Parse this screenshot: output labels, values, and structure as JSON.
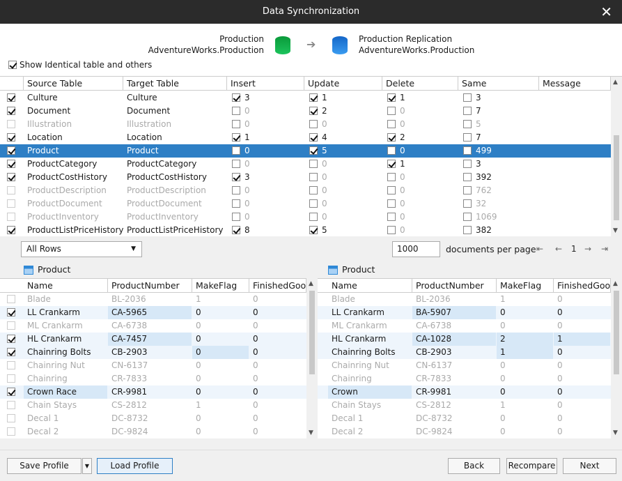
{
  "window": {
    "title": "Data Synchronization",
    "close": "✕"
  },
  "header": {
    "source": {
      "line1": "Production",
      "line2": "AdventureWorks.Production"
    },
    "target": {
      "line1": "Production Replication",
      "line2": "AdventureWorks.Production"
    },
    "arrow": "➔",
    "show_identical": {
      "label": "Show Identical table and others",
      "checked": true
    }
  },
  "tables": {
    "columns": [
      "Source Table",
      "Target Table",
      "Insert",
      "Update",
      "Delete",
      "Same",
      "Message"
    ],
    "rows": [
      {
        "checked": true,
        "source": "Culture",
        "target": "Culture",
        "insert": {
          "c": true,
          "v": "3"
        },
        "update": {
          "c": true,
          "v": "1"
        },
        "delete": {
          "c": true,
          "v": "1"
        },
        "same": {
          "c": false,
          "v": "3"
        },
        "dim": false,
        "sel": false
      },
      {
        "checked": true,
        "source": "Document",
        "target": "Document",
        "insert": {
          "c": false,
          "v": "0"
        },
        "update": {
          "c": true,
          "v": "2"
        },
        "delete": {
          "c": false,
          "v": "0"
        },
        "same": {
          "c": false,
          "v": "7"
        },
        "dim": false,
        "sel": false
      },
      {
        "checked": false,
        "source": "Illustration",
        "target": "Illustration",
        "insert": {
          "c": false,
          "v": "0"
        },
        "update": {
          "c": false,
          "v": "0"
        },
        "delete": {
          "c": false,
          "v": "0"
        },
        "same": {
          "c": false,
          "v": "5"
        },
        "dim": true,
        "sel": false
      },
      {
        "checked": true,
        "source": "Location",
        "target": "Location",
        "insert": {
          "c": true,
          "v": "1"
        },
        "update": {
          "c": true,
          "v": "4"
        },
        "delete": {
          "c": true,
          "v": "2"
        },
        "same": {
          "c": false,
          "v": "7"
        },
        "dim": false,
        "sel": false
      },
      {
        "checked": true,
        "source": "Product",
        "target": "Product",
        "insert": {
          "c": false,
          "v": "0"
        },
        "update": {
          "c": true,
          "v": "5"
        },
        "delete": {
          "c": false,
          "v": "0"
        },
        "same": {
          "c": false,
          "v": "499"
        },
        "dim": false,
        "sel": true
      },
      {
        "checked": true,
        "source": "ProductCategory",
        "target": "ProductCategory",
        "insert": {
          "c": false,
          "v": "0"
        },
        "update": {
          "c": false,
          "v": "0"
        },
        "delete": {
          "c": true,
          "v": "1"
        },
        "same": {
          "c": false,
          "v": "3"
        },
        "dim": false,
        "sel": false
      },
      {
        "checked": true,
        "source": "ProductCostHistory",
        "target": "ProductCostHistory",
        "insert": {
          "c": true,
          "v": "3"
        },
        "update": {
          "c": false,
          "v": "0"
        },
        "delete": {
          "c": false,
          "v": "0"
        },
        "same": {
          "c": false,
          "v": "392"
        },
        "dim": false,
        "sel": false
      },
      {
        "checked": false,
        "source": "ProductDescription",
        "target": "ProductDescription",
        "insert": {
          "c": false,
          "v": "0"
        },
        "update": {
          "c": false,
          "v": "0"
        },
        "delete": {
          "c": false,
          "v": "0"
        },
        "same": {
          "c": false,
          "v": "762"
        },
        "dim": true,
        "sel": false
      },
      {
        "checked": false,
        "source": "ProductDocument",
        "target": "ProductDocument",
        "insert": {
          "c": false,
          "v": "0"
        },
        "update": {
          "c": false,
          "v": "0"
        },
        "delete": {
          "c": false,
          "v": "0"
        },
        "same": {
          "c": false,
          "v": "32"
        },
        "dim": true,
        "sel": false
      },
      {
        "checked": false,
        "source": "ProductInventory",
        "target": "ProductInventory",
        "insert": {
          "c": false,
          "v": "0"
        },
        "update": {
          "c": false,
          "v": "0"
        },
        "delete": {
          "c": false,
          "v": "0"
        },
        "same": {
          "c": false,
          "v": "1069"
        },
        "dim": true,
        "sel": false
      },
      {
        "checked": true,
        "source": "ProductListPriceHistory",
        "target": "ProductListPriceHistory",
        "insert": {
          "c": true,
          "v": "8"
        },
        "update": {
          "c": true,
          "v": "5"
        },
        "delete": {
          "c": false,
          "v": "0"
        },
        "same": {
          "c": false,
          "v": "382"
        },
        "dim": false,
        "sel": false
      }
    ]
  },
  "filter": {
    "value": "All Rows"
  },
  "paging": {
    "per_page": "1000",
    "label": "documents per page",
    "page": "1"
  },
  "left": {
    "title": "Product",
    "columns": [
      "Name",
      "ProductNumber",
      "MakeFlag",
      "FinishedGoo"
    ],
    "rows": [
      {
        "checked": false,
        "cells": [
          "Blade",
          "BL-2036",
          "1",
          "0"
        ],
        "dim": true,
        "hl": []
      },
      {
        "checked": true,
        "cells": [
          "LL Crankarm",
          "CA-5965",
          "0",
          "0"
        ],
        "dim": false,
        "hl": [
          1
        ]
      },
      {
        "checked": false,
        "cells": [
          "ML Crankarm",
          "CA-6738",
          "0",
          "0"
        ],
        "dim": true,
        "hl": []
      },
      {
        "checked": true,
        "cells": [
          "HL Crankarm",
          "CA-7457",
          "0",
          "0"
        ],
        "dim": false,
        "hl": [
          1
        ]
      },
      {
        "checked": true,
        "cells": [
          "Chainring Bolts",
          "CB-2903",
          "0",
          "0"
        ],
        "dim": false,
        "hl": [
          2
        ]
      },
      {
        "checked": false,
        "cells": [
          "Chainring Nut",
          "CN-6137",
          "0",
          "0"
        ],
        "dim": true,
        "hl": []
      },
      {
        "checked": false,
        "cells": [
          "Chainring",
          "CR-7833",
          "0",
          "0"
        ],
        "dim": true,
        "hl": []
      },
      {
        "checked": true,
        "cells": [
          "Crown Race",
          "CR-9981",
          "0",
          "0"
        ],
        "dim": false,
        "hl": [
          0
        ]
      },
      {
        "checked": false,
        "cells": [
          "Chain Stays",
          "CS-2812",
          "1",
          "0"
        ],
        "dim": true,
        "hl": []
      },
      {
        "checked": false,
        "cells": [
          "Decal 1",
          "DC-8732",
          "0",
          "0"
        ],
        "dim": true,
        "hl": []
      },
      {
        "checked": false,
        "cells": [
          "Decal 2",
          "DC-9824",
          "0",
          "0"
        ],
        "dim": true,
        "hl": []
      }
    ]
  },
  "right": {
    "title": "Product",
    "columns": [
      "Name",
      "ProductNumber",
      "MakeFlag",
      "FinishedGoo"
    ],
    "rows": [
      {
        "cells": [
          "Blade",
          "BL-2036",
          "1",
          "0"
        ],
        "dim": true,
        "hl": []
      },
      {
        "cells": [
          "LL Crankarm",
          "BA-5907",
          "0",
          "0"
        ],
        "dim": false,
        "hl": [
          1
        ]
      },
      {
        "cells": [
          "ML Crankarm",
          "CA-6738",
          "0",
          "0"
        ],
        "dim": true,
        "hl": []
      },
      {
        "cells": [
          "HL Crankarm",
          "CA-1028",
          "2",
          "1"
        ],
        "dim": false,
        "hl": [
          1,
          2,
          3
        ]
      },
      {
        "cells": [
          "Chainring Bolts",
          "CB-2903",
          "1",
          "0"
        ],
        "dim": false,
        "hl": [
          2
        ]
      },
      {
        "cells": [
          "Chainring Nut",
          "CN-6137",
          "0",
          "0"
        ],
        "dim": true,
        "hl": []
      },
      {
        "cells": [
          "Chainring",
          "CR-7833",
          "0",
          "0"
        ],
        "dim": true,
        "hl": []
      },
      {
        "cells": [
          "Crown",
          "CR-9981",
          "0",
          "0"
        ],
        "dim": false,
        "hl": [
          0
        ]
      },
      {
        "cells": [
          "Chain Stays",
          "CS-2812",
          "1",
          "0"
        ],
        "dim": true,
        "hl": []
      },
      {
        "cells": [
          "Decal 1",
          "DC-8732",
          "0",
          "0"
        ],
        "dim": true,
        "hl": []
      },
      {
        "cells": [
          "Decal 2",
          "DC-9824",
          "0",
          "0"
        ],
        "dim": true,
        "hl": []
      }
    ]
  },
  "footer": {
    "save": "Save Profile",
    "load": "Load Profile",
    "back": "Back",
    "recompare": "Recompare",
    "next": "Next"
  }
}
